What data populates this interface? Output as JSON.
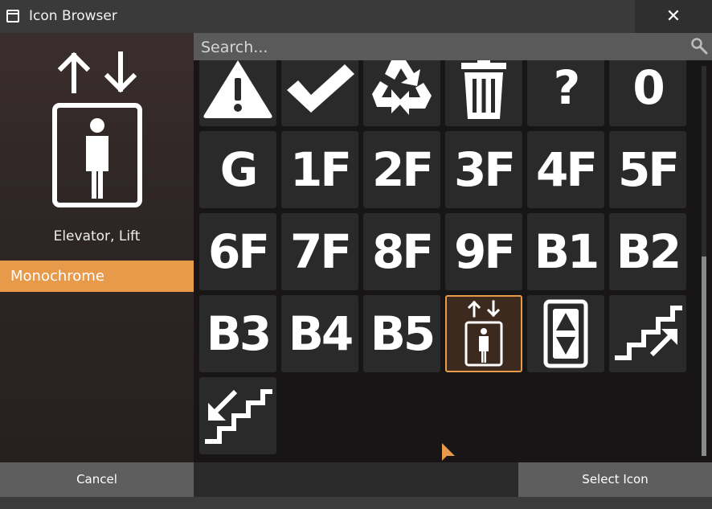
{
  "window": {
    "title": "Icon Browser",
    "close_glyph": "✕"
  },
  "preview": {
    "icon": "elevator-icon",
    "name": "Elevator, Lift"
  },
  "categories": [
    {
      "label": "Monochrome",
      "selected": true
    }
  ],
  "search": {
    "placeholder": "Search...",
    "value": ""
  },
  "icons": [
    {
      "name": "warning-icon",
      "label": ""
    },
    {
      "name": "check-icon",
      "label": ""
    },
    {
      "name": "recycle-icon",
      "label": ""
    },
    {
      "name": "trash-icon",
      "label": ""
    },
    {
      "name": "question-icon",
      "label": "?"
    },
    {
      "name": "floor-0",
      "label": "0"
    },
    {
      "name": "floor-g",
      "label": "G"
    },
    {
      "name": "floor-1f",
      "label": "1F"
    },
    {
      "name": "floor-2f",
      "label": "2F"
    },
    {
      "name": "floor-3f",
      "label": "3F"
    },
    {
      "name": "floor-4f",
      "label": "4F"
    },
    {
      "name": "floor-5f",
      "label": "5F"
    },
    {
      "name": "floor-6f",
      "label": "6F"
    },
    {
      "name": "floor-7f",
      "label": "7F"
    },
    {
      "name": "floor-8f",
      "label": "8F"
    },
    {
      "name": "floor-9f",
      "label": "9F"
    },
    {
      "name": "floor-b1",
      "label": "B1"
    },
    {
      "name": "floor-b2",
      "label": "B2"
    },
    {
      "name": "floor-b3",
      "label": "B3"
    },
    {
      "name": "floor-b4",
      "label": "B4"
    },
    {
      "name": "floor-b5",
      "label": "B5"
    },
    {
      "name": "elevator-icon",
      "label": "",
      "selected": true
    },
    {
      "name": "elevator-buttons-icon",
      "label": ""
    },
    {
      "name": "stairs-up-icon",
      "label": ""
    },
    {
      "name": "stairs-down-icon",
      "label": ""
    }
  ],
  "buttons": {
    "cancel": "Cancel",
    "select": "Select Icon"
  },
  "colors": {
    "accent": "#e69a4a",
    "panel": "#5e5e5e"
  }
}
